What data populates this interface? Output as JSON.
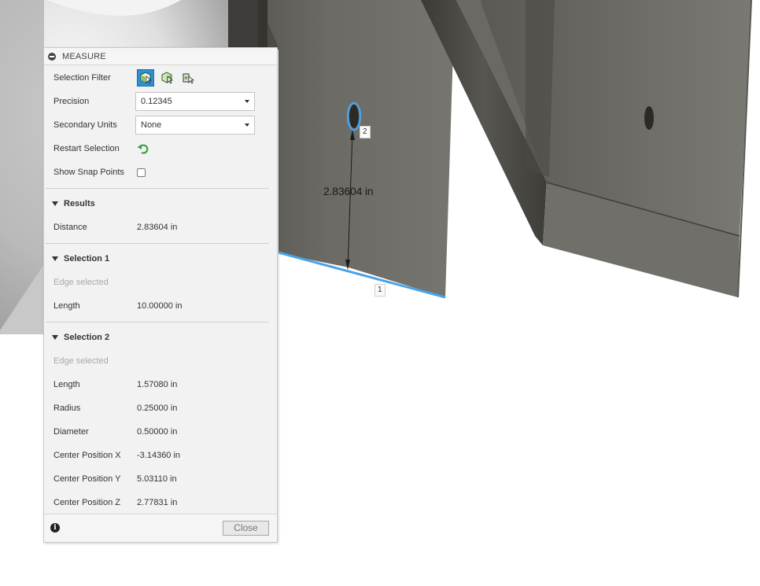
{
  "viewport": {
    "dimension_label": "2.83604 in",
    "pick_tag_1": "1",
    "pick_tag_2": "2",
    "highlight_color": "#4aa3e8"
  },
  "dialog": {
    "title": "MEASURE",
    "settings": {
      "selection_filter_label": "Selection Filter",
      "precision_label": "Precision",
      "precision_value": "0.12345",
      "secondary_units_label": "Secondary Units",
      "secondary_units_value": "None",
      "restart_selection_label": "Restart Selection",
      "show_snap_points_label": "Show Snap Points",
      "show_snap_points_checked": false
    },
    "results": {
      "heading": "Results",
      "distance_label": "Distance",
      "distance_value": "2.83604 in"
    },
    "selection1": {
      "heading": "Selection 1",
      "type": "Edge selected",
      "length_label": "Length",
      "length_value": "10.00000 in"
    },
    "selection2": {
      "heading": "Selection 2",
      "type": "Edge selected",
      "length_label": "Length",
      "length_value": "1.57080 in",
      "radius_label": "Radius",
      "radius_value": "0.25000 in",
      "diameter_label": "Diameter",
      "diameter_value": "0.50000 in",
      "cx_label": "Center Position X",
      "cx_value": "-3.14360 in",
      "cy_label": "Center Position Y",
      "cy_value": "5.03110 in",
      "cz_label": "Center Position Z",
      "cz_value": "2.77831 in"
    },
    "footer": {
      "info_glyph": "i",
      "close_label": "Close"
    },
    "accent_color": "#2d8fd5",
    "restart_icon_color": "#3aa14a"
  }
}
